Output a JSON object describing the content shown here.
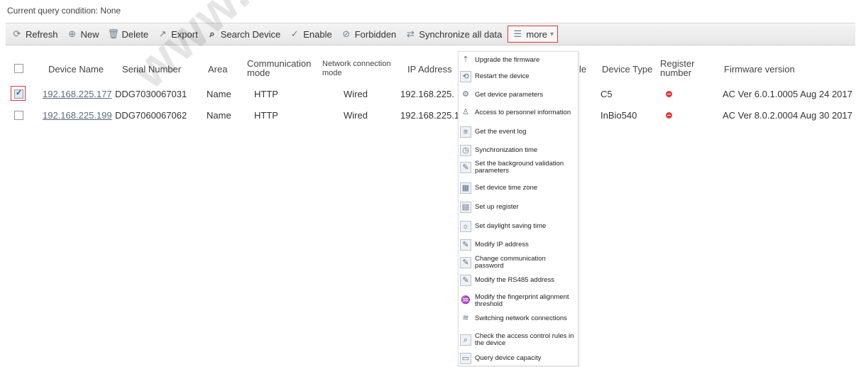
{
  "condition": "Current query condition: None",
  "toolbar": {
    "refresh": "Refresh",
    "new": "New",
    "delete": "Delete",
    "export": "Export",
    "search": "Search Device",
    "enable": "Enable",
    "forbidden": "Forbidden",
    "sync": "Synchronize all data",
    "more": "more"
  },
  "columns": {
    "device_name": "Device Name",
    "serial": "Serial Number",
    "area": "Area",
    "comm_mode": "Communication mode",
    "net_mode": "Network connection mode",
    "ip": "IP Address",
    "partial": "le",
    "device_type": "Device Type",
    "register": "Register number",
    "firmware": "Firmware version"
  },
  "rows": [
    {
      "checked": true,
      "device_name": "192.168.225.177",
      "serial": "DDG7030067031",
      "area": "Name",
      "comm_mode": "HTTP",
      "net_mode": "Wired",
      "ip": "192.168.225.",
      "device_type": "C5",
      "firmware": "AC Ver 6.0.1.0005 Aug 24 2017"
    },
    {
      "checked": false,
      "device_name": "192.168.225.199",
      "serial": "DDG7060067062",
      "area": "Name",
      "comm_mode": "HTTP",
      "net_mode": "Wired",
      "ip": "192.168.225.1",
      "device_type": "InBio540",
      "firmware": "AC Ver 8.0.2.0004 Aug 30 2017"
    }
  ],
  "menu": [
    "Upgrade the firmware",
    "Restart the device",
    "Get device parameters",
    "Access to personnel information",
    "Get the event log",
    "Synchronization time",
    "Set the background validation parameters",
    "Set device time zone",
    "Set up register",
    "Set daylight saving time",
    "Modify IP address",
    "Change communication password",
    "Modify the RS485 address",
    "Modify the fingerprint alignment threshold",
    "Switching network connections",
    "Check the access control rules in the device",
    "Query device capacity"
  ],
  "watermark": "www.zkte",
  "colors": {
    "highlight": "#e0343e",
    "status_dot": "#e23a3a",
    "link": "#5b6b80"
  }
}
